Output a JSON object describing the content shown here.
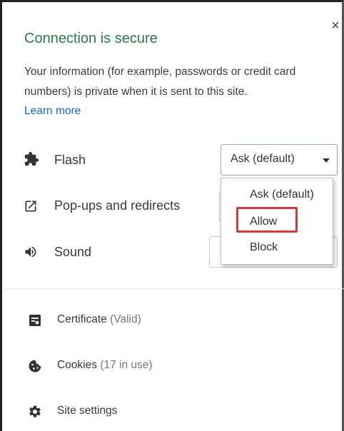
{
  "header": {
    "title": "Connection is secure",
    "description": "Your information (for example, passwords or credit card numbers) is private when it is sent to this site.",
    "learn_more": "Learn more"
  },
  "permissions": [
    {
      "label": "Flash",
      "icon": "puzzle-icon",
      "value": "Ask (default)"
    },
    {
      "label": "Pop-ups and redirects",
      "icon": "popup-icon"
    },
    {
      "label": "Sound",
      "icon": "speaker-icon"
    }
  ],
  "dropdown": {
    "options": [
      "Ask (default)",
      "Allow",
      "Block"
    ],
    "highlighted": "Allow"
  },
  "site_info": [
    {
      "label": "Certificate",
      "sub": "(Valid)",
      "icon": "certificate-icon"
    },
    {
      "label": "Cookies",
      "sub": "(17 in use)",
      "icon": "cookie-icon"
    },
    {
      "label": "Site settings",
      "sub": "",
      "icon": "gear-icon"
    }
  ],
  "colors": {
    "title": "#2e7d48",
    "link": "#1a66c9",
    "highlight_border": "#d23a3a",
    "select_border": "#8aa7d6"
  }
}
